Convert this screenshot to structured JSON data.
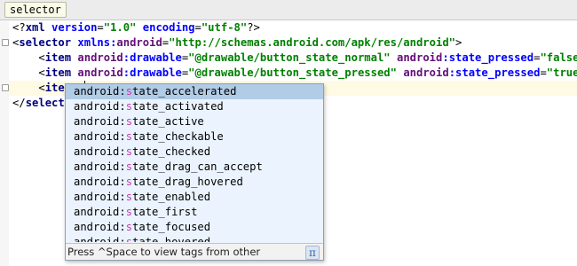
{
  "breadcrumb": {
    "label": "selector"
  },
  "code": {
    "line1": {
      "open": "<?",
      "tag": "xml",
      "attr1": "version",
      "eq1": "=",
      "val1": "\"1.0\"",
      "attr2": "encoding",
      "eq2": "=",
      "val2": "\"utf-8\"",
      "close": "?>"
    },
    "line2": {
      "open": "<",
      "tag": "selector",
      "ns": "xmlns:",
      "nsname": "android",
      "eq": "=",
      "val": "\"http://schemas.android.com/apk/res/android\"",
      "close": ">"
    },
    "line3": {
      "open": "<",
      "tag": "item",
      "ns1": "android",
      "attr1": ":drawable",
      "eq1": "=",
      "val1": "\"@drawable/button_state_normal\"",
      "ns2": "android",
      "attr2": ":state_pressed",
      "eq2": "=",
      "val2": "\"false\"",
      "close": " />"
    },
    "line4": {
      "open": "<",
      "tag": "item",
      "ns1": "android",
      "attr1": ":drawable",
      "eq1": "=",
      "val1": "\"@drawable/button_state_pressed\"",
      "ns2": "android",
      "attr2": ":state_pressed",
      "eq2": "=",
      "val2": "\"true\"",
      "close": " />"
    },
    "line5": {
      "open": "<",
      "tag": "item",
      "typed": "s"
    },
    "line6": {
      "open": "</",
      "tag": "selecto"
    }
  },
  "completion": {
    "prefix": "android:",
    "match": "s",
    "items": [
      {
        "rest": "tate_accelerated"
      },
      {
        "rest": "tate_activated"
      },
      {
        "rest": "tate_active"
      },
      {
        "rest": "tate_checkable"
      },
      {
        "rest": "tate_checked"
      },
      {
        "rest": "tate_drag_can_accept"
      },
      {
        "rest": "tate_drag_hovered"
      },
      {
        "rest": "tate_enabled"
      },
      {
        "rest": "tate_first"
      },
      {
        "rest": "tate_focused"
      },
      {
        "rest": "tate_hovered"
      }
    ],
    "selected_index": 0,
    "footer": "Press ^Space to view tags from other namespaces",
    "pi_symbol": "π"
  },
  "colors": {
    "tag": "#000080",
    "attribute": "#0000ff",
    "namespace": "#660e7a",
    "string": "#008000",
    "match_highlight": "#c83db3",
    "selection": "#b1cce6",
    "popup_bg": "#ebf4fe",
    "current_line": "#fffae3"
  },
  "icons": {
    "fold": "fold-marker-icon",
    "pi": "pi-icon"
  }
}
